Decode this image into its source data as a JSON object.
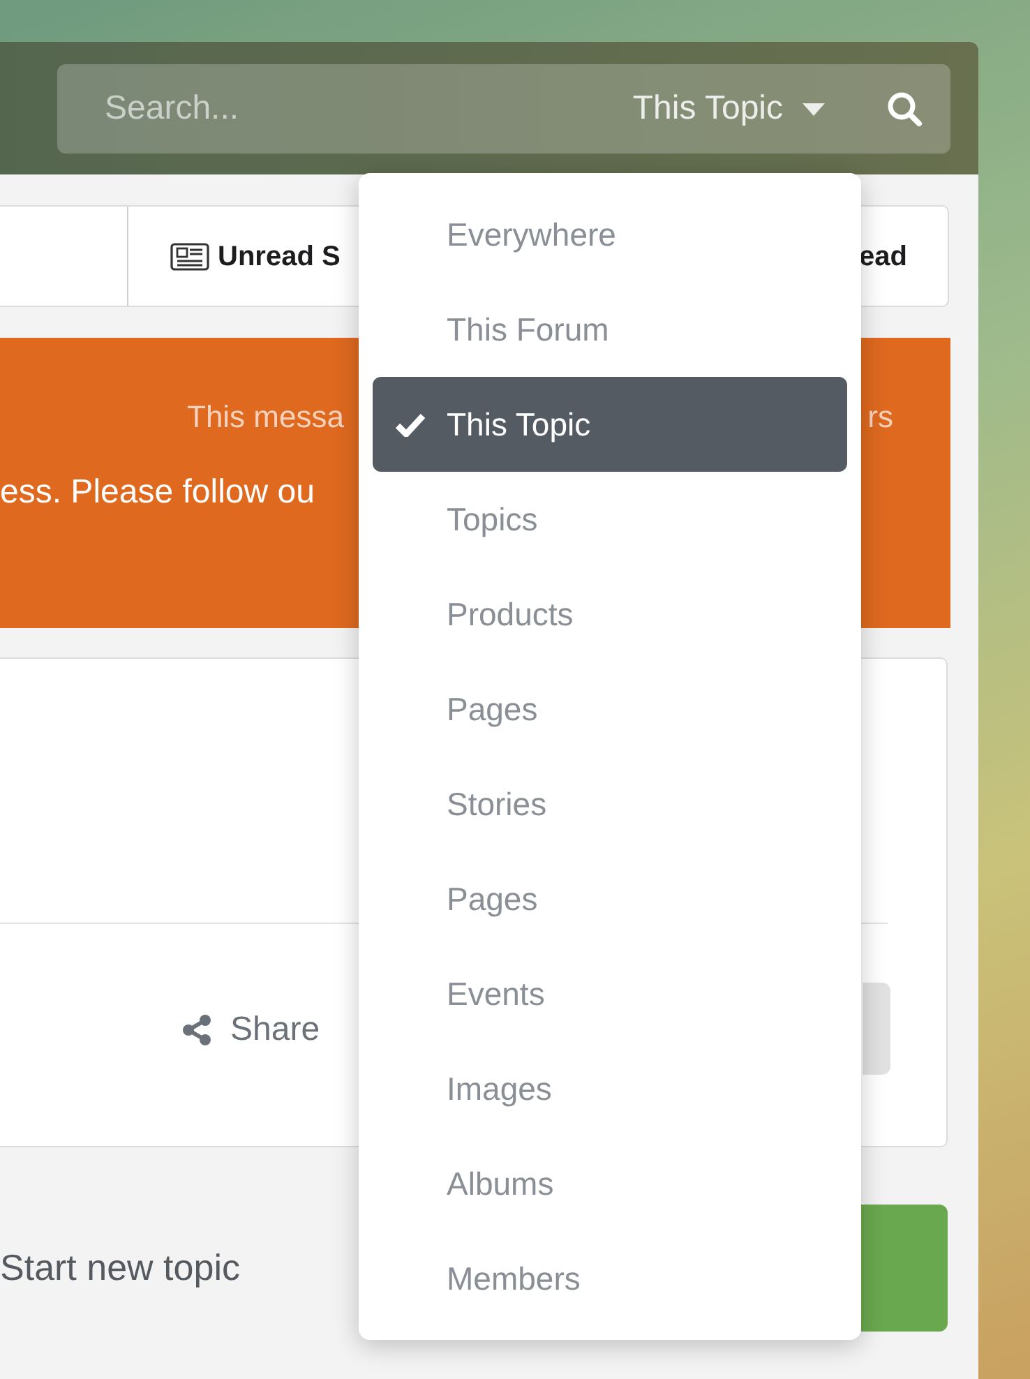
{
  "search": {
    "placeholder": "Search...",
    "scope": "This Topic"
  },
  "activity_bar": {
    "items": [
      "Unread S",
      "ead"
    ]
  },
  "notice": {
    "line_1_start": "This messa",
    "line_1_end": "rs",
    "line_2": "ess. Please follow ou"
  },
  "post_actions": {
    "share": "Share"
  },
  "start_topic": "Start new topic",
  "scope_menu": {
    "items": [
      {
        "label": "Everywhere",
        "selected": false
      },
      {
        "label": "This Forum",
        "selected": false
      },
      {
        "label": "This Topic",
        "selected": true
      },
      {
        "label": "Topics",
        "selected": false
      },
      {
        "label": "Products",
        "selected": false
      },
      {
        "label": "Pages",
        "selected": false
      },
      {
        "label": "Stories",
        "selected": false
      },
      {
        "label": "Pages",
        "selected": false
      },
      {
        "label": "Events",
        "selected": false
      },
      {
        "label": "Images",
        "selected": false
      },
      {
        "label": "Albums",
        "selected": false
      },
      {
        "label": "Members",
        "selected": false
      }
    ]
  }
}
